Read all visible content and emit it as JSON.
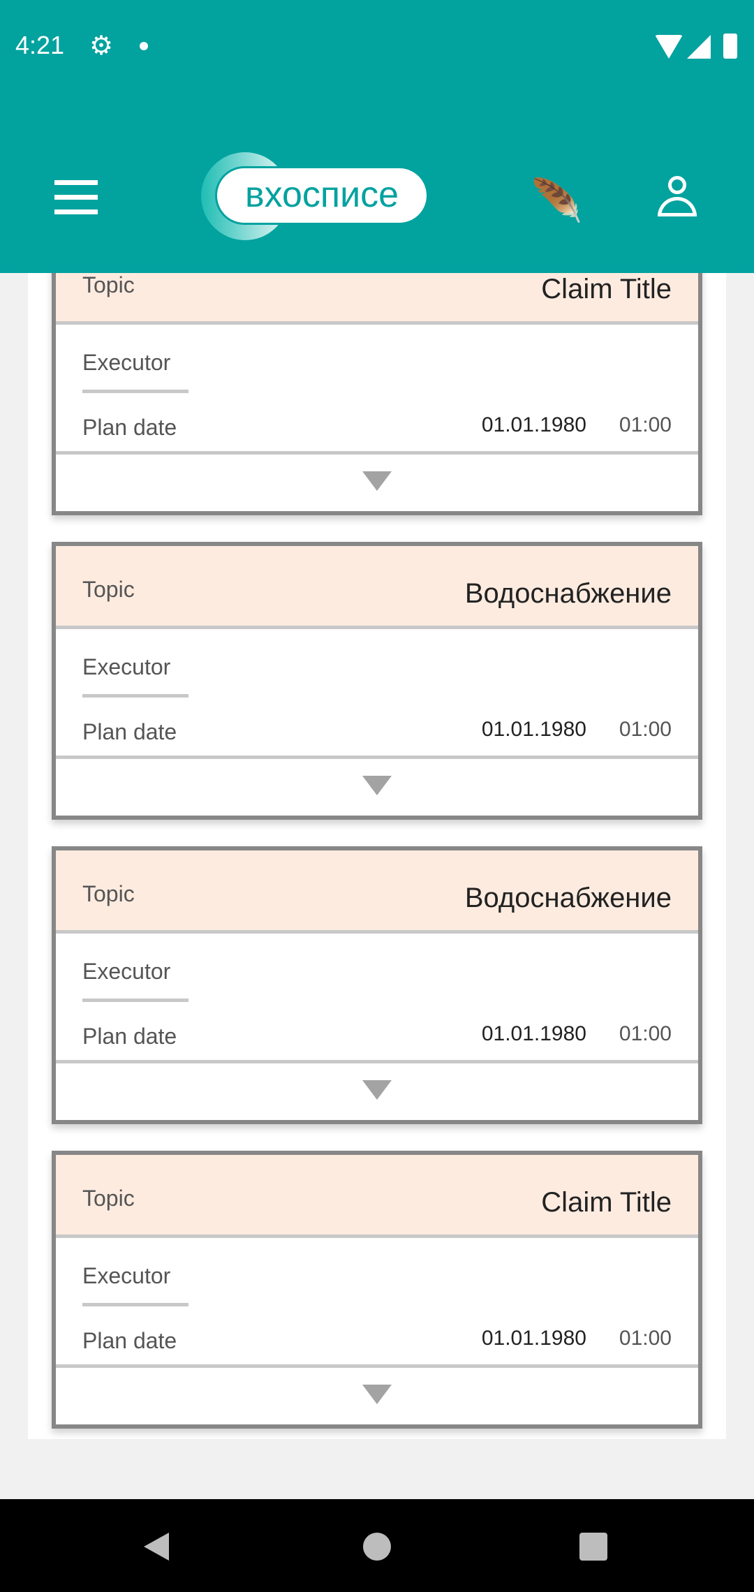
{
  "status_bar": {
    "time": "4:21",
    "icons": [
      "gear-icon",
      "notification-dot-icon",
      "wifi-icon",
      "signal-icon",
      "battery-icon"
    ]
  },
  "app_bar": {
    "logo_text": "вхосписе",
    "icons": [
      "menu-icon",
      "feather-icon",
      "user-icon"
    ],
    "color": "#02a29f"
  },
  "cards": [
    {
      "topic_label": "Topic",
      "topic": "Claim Title",
      "executor_label": "Executor",
      "plan_date_label": "Plan date",
      "date": "01.01.1980",
      "time": "01:00"
    },
    {
      "topic_label": "Topic",
      "topic": "Водоснабжение",
      "executor_label": "Executor",
      "plan_date_label": "Plan date",
      "date": "01.01.1980",
      "time": "01:00"
    },
    {
      "topic_label": "Topic",
      "topic": "Водоснабжение",
      "executor_label": "Executor",
      "plan_date_label": "Plan date",
      "date": "01.01.1980",
      "time": "01:00"
    },
    {
      "topic_label": "Topic",
      "topic": "Claim Title",
      "executor_label": "Executor",
      "plan_date_label": "Plan date",
      "date": "01.01.1980",
      "time": "01:00"
    }
  ]
}
